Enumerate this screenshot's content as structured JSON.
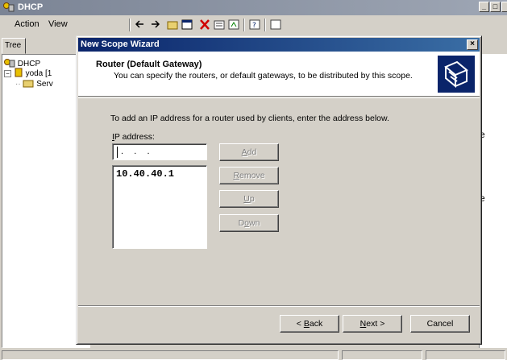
{
  "main_window": {
    "title": "DHCP",
    "menu": [
      "Action",
      "View"
    ],
    "tree_tab": "Tree",
    "tree": [
      {
        "label": "DHCP"
      },
      {
        "label": "yoda [1"
      },
      {
        "label": "Serv"
      }
    ],
    "right_pane_glyph": "e"
  },
  "wizard": {
    "title": "New Scope Wizard",
    "header_title": "Router (Default Gateway)",
    "header_subtitle": "You can specify the routers, or default gateways, to be distributed by this scope.",
    "instruction": "To add an IP address for a router used by clients, enter the address below.",
    "ip_label_underlined": "I",
    "ip_label_rest": "P address:",
    "ip_input_value": " .   .   .",
    "ip_list": [
      "10.40.40.1"
    ],
    "buttons": {
      "add": "Add",
      "remove": "Remove",
      "up": "Up",
      "down": "Down",
      "back": "< Back",
      "next": "Next >",
      "cancel": "Cancel"
    },
    "close_glyph": "×"
  },
  "colors": {
    "wizard_title_start": "#0a246a",
    "wizard_title_end": "#3a6ea5",
    "face": "#d4d0c8"
  }
}
